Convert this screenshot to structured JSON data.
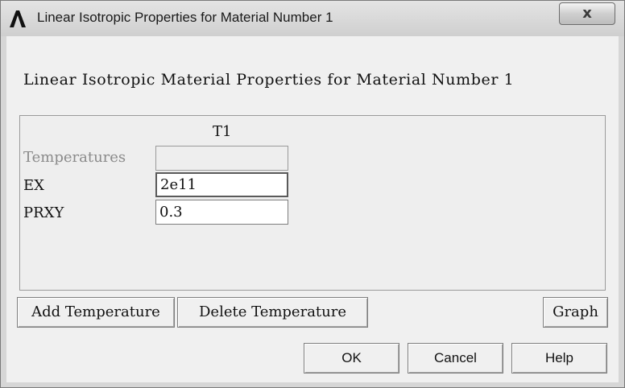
{
  "window": {
    "title": "Linear Isotropic Properties for Material Number 1",
    "close_glyph": "x",
    "icon": "ansys-logo-icon"
  },
  "dialog": {
    "heading": "Linear Isotropic Material Properties for Material Number 1",
    "column_header": "T1",
    "rows": [
      {
        "label": "Temperatures",
        "value": "",
        "enabled": false
      },
      {
        "label": "EX",
        "value": "2e11",
        "enabled": true
      },
      {
        "label": "PRXY",
        "value": "0.3",
        "enabled": true
      }
    ]
  },
  "buttons": {
    "add_temperature": "Add Temperature",
    "delete_temperature": "Delete Temperature",
    "graph": "Graph",
    "ok": "OK",
    "cancel": "Cancel",
    "help": "Help"
  }
}
